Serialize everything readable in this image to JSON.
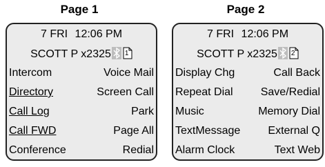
{
  "pages": [
    {
      "title": "Page 1",
      "status": {
        "day_date": "7 FRI",
        "time": "12:06 PM",
        "user": "SCOTT P x2325",
        "page_num": "1"
      },
      "keys": [
        {
          "left": "Intercom",
          "right": "Voice Mail"
        },
        {
          "left": "Directory",
          "right": "Screen Call"
        },
        {
          "left": "Call Log",
          "right": "Park"
        },
        {
          "left": "Call FWD",
          "right": "Page All"
        },
        {
          "left": "Conference",
          "right": "Redial"
        }
      ]
    },
    {
      "title": "Page 2",
      "status": {
        "day_date": "7 FRI",
        "time": "12:06 PM",
        "user": "SCOTT P x2325",
        "page_num": "2"
      },
      "keys": [
        {
          "left": "Display Chg",
          "right": "Call Back"
        },
        {
          "left": "Repeat Dial",
          "right": "Save/Redial"
        },
        {
          "left": "Music",
          "right": "Memory Dial"
        },
        {
          "left": "TextMessage",
          "right": "External Q"
        },
        {
          "left": "Alarm Clock",
          "right": "Text Web"
        }
      ]
    }
  ],
  "icons": {
    "status": "bluetooth-icon",
    "page": "page-indicator-icon"
  },
  "colors": {
    "screen_bg": "#ebebeb",
    "icon_bg": "#bdbdbd",
    "border": "#222222"
  }
}
